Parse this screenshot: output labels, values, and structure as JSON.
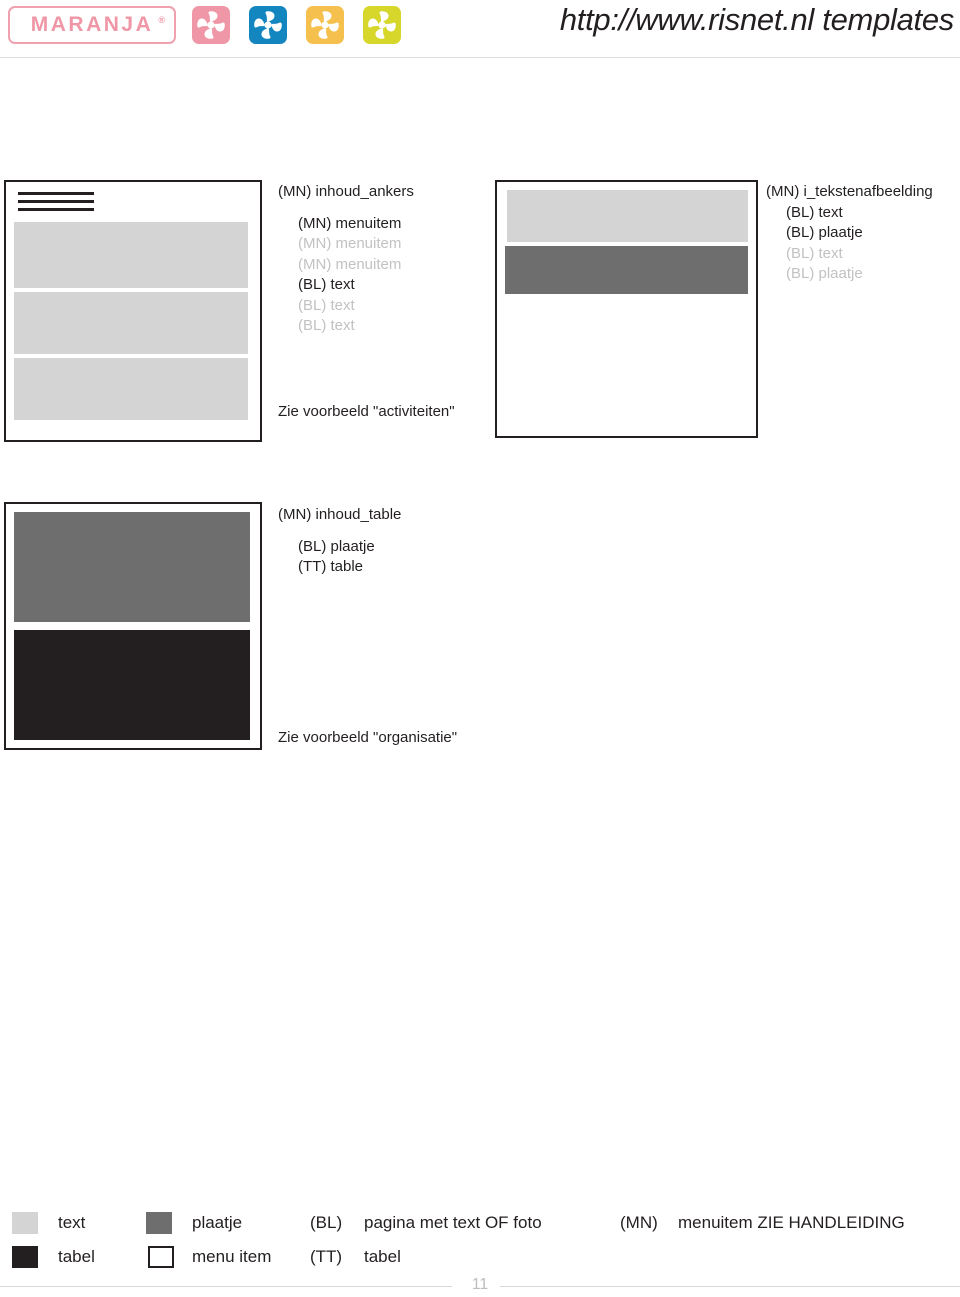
{
  "header": {
    "logo_text": "MARANJA",
    "logo_registered": "®",
    "title": "http://www.risnet.nl templates",
    "logo_border_color": "#f0a0ae",
    "logo_text_color": "#ef97a6",
    "flowers": [
      {
        "name": "flower-icon-pink",
        "color": "#ef97a6"
      },
      {
        "name": "flower-icon-blue",
        "color": "#1386c0"
      },
      {
        "name": "flower-icon-orange",
        "color": "#f5c04e"
      },
      {
        "name": "flower-icon-green",
        "color": "#d6d62b"
      }
    ]
  },
  "sections": [
    {
      "id": "inhoud-ankers",
      "title": "(MN) inhoud_ankers",
      "items": [
        {
          "label": "(MN) menuitem",
          "dim": false
        },
        {
          "label": "(MN) menuitem",
          "dim": true
        },
        {
          "label": "(MN) menuitem",
          "dim": true
        },
        {
          "label": "(BL) text",
          "dim": false
        },
        {
          "label": "(BL) text",
          "dim": true
        },
        {
          "label": "(BL) text",
          "dim": true
        }
      ],
      "caption": "Zie voorbeeld \"activiteiten\""
    },
    {
      "id": "i-tekstenafbeelding",
      "title": "(MN) i_tekstenafbeelding",
      "items": [
        {
          "label": "(BL) text",
          "dim": false
        },
        {
          "label": "(BL) plaatje",
          "dim": false
        },
        {
          "label": "(BL) text",
          "dim": true
        },
        {
          "label": "(BL) plaatje",
          "dim": true
        }
      ],
      "caption": ""
    },
    {
      "id": "inhoud-table",
      "title": "(MN) inhoud_table",
      "items": [
        {
          "label": "(BL) plaatje",
          "dim": false
        },
        {
          "label": "(TT) table",
          "dim": false
        }
      ],
      "caption": "Zie voorbeeld \"organisatie\""
    }
  ],
  "legend": {
    "swatches": [
      {
        "name": "swatch-text",
        "label": "text",
        "color": "#d4d4d4",
        "outlined": false
      },
      {
        "name": "swatch-tabel",
        "label": "tabel",
        "color": "#231f20",
        "outlined": false
      },
      {
        "name": "swatch-plaatje",
        "label": "plaatje",
        "color": "#6e6e6e",
        "outlined": false
      },
      {
        "name": "swatch-menu-item",
        "label": "menu item",
        "color": "#ffffff",
        "outlined": true
      }
    ],
    "codes": [
      {
        "code": "(BL)",
        "desc": "pagina met text OF foto"
      },
      {
        "code": "(TT)",
        "desc": "tabel"
      },
      {
        "code": "(MN)",
        "desc": "menuitem ZIE HANDLEIDING"
      }
    ]
  },
  "footer": {
    "page_number": "11"
  },
  "palette": {
    "light_gray": "#d4d4d4",
    "mid_gray": "#6e6e6e",
    "dark": "#231f20",
    "outline": "#231f20"
  }
}
